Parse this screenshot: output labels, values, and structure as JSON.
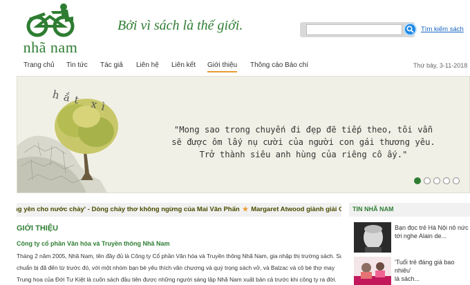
{
  "header": {
    "logo_text": "nhã nam",
    "slogan": "Bởi vì sách là thế giới.",
    "search": {
      "value": "",
      "placeholder": "",
      "link_label": "Tìm kiếm sách"
    }
  },
  "nav": {
    "items": [
      {
        "label": "Trang chủ"
      },
      {
        "label": "Tin tức"
      },
      {
        "label": "Tác giả"
      },
      {
        "label": "Liên hệ"
      },
      {
        "label": "Liên kết"
      },
      {
        "label": "Giới thiệu",
        "active": true
      },
      {
        "label": "Thông cáo Báo chí"
      }
    ],
    "date": "Thứ bảy, 3-11-2018"
  },
  "banner": {
    "art_text": "hắt xì",
    "quote_lines": [
      "\"Mong sao trong chuyến đi đẹp đẽ tiếp theo, tôi vẫn",
      "sẽ được ôm lấy nụ cười của người con gái thương yêu.",
      "Trở thành siêu anh hùng của riêng cô ấy.\""
    ],
    "dots_total": 5,
    "dots_active": 1
  },
  "ticker": {
    "item1": "ng yên cho nước chảy' - Dòng chảy thơ không ngừng của Mai Văn Phấn",
    "item2": "Margaret Atwood giành giải German Peace P"
  },
  "main": {
    "section_title": "GIỚI THIỆU",
    "company_title": "Công ty cổ phần Văn hóa và Truyền thông Nhã Nam",
    "paragraph_lines": [
      "Tháng 2 năm 2005, Nhã Nam, tên đầy đủ là Công ty Cổ phần Văn hóa và Truyền thông Nhã Nam, gia nhập thị trường sách. Sự",
      "chuẩn bị đã đến từ trước đó, với một nhóm bạn bè yêu thích văn chương và quý trọng sách vở, và Balzac và cô bé thợ may",
      "Trung hoa của Đới Tư Kiệt là cuốn sách đầu tiên được những người sáng lập Nhã Nam xuất bản cả trước khi công ty ra đời."
    ]
  },
  "sidebar": {
    "title": "TIN NHÃ NAM",
    "news": [
      {
        "lines": [
          "Bạn đọc trẻ Hà Nội nô nức",
          "tới nghe Alain de..."
        ]
      },
      {
        "lines": [
          "'Tuổi trẻ đáng giá bao nhiêu'",
          "là sách..."
        ]
      }
    ]
  },
  "colors": {
    "brand_green": "#2e7d32",
    "accent_orange": "#e89b2e",
    "link_blue": "#1565c0"
  }
}
